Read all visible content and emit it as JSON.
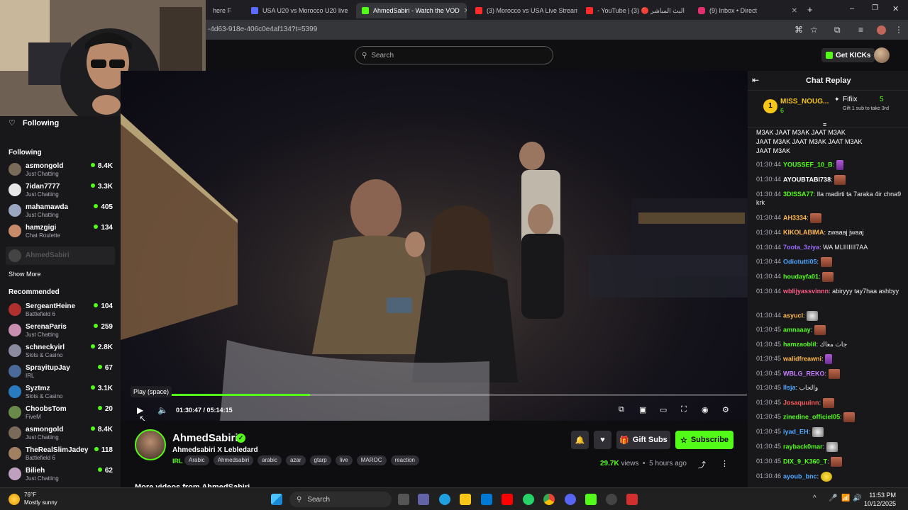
{
  "browser": {
    "tabs": [
      {
        "label": "here F",
        "active": false,
        "color": "#888"
      },
      {
        "label": "USA U20 vs Morocco U20 live",
        "active": false,
        "color": "#5b6cff"
      },
      {
        "label": "AhmedSabiri - Watch the VOD",
        "active": true,
        "color": "#53fc18"
      },
      {
        "label": "(3) Morocco vs USA Live Stream",
        "active": false,
        "color": "#ff2a2a"
      },
      {
        "label": "- YouTube | البث المباشر 🔴 (3)",
        "active": false,
        "color": "#ff2a2a"
      },
      {
        "label": "(9) Inbox • Direct",
        "active": false,
        "color": "#e1306c"
      }
    ],
    "url": "-4d63-918e-406c0e4af134?t=5399"
  },
  "topnav": {
    "search_placeholder": "Search",
    "get_kicks": "Get KICKs"
  },
  "sidebar": {
    "following_title": "Following",
    "following_section": "Following",
    "following": [
      {
        "name": "asmongold",
        "category": "Just Chatting",
        "viewers": "8.4K",
        "color": "#7a6a5a"
      },
      {
        "name": "7idan7777",
        "category": "Just Chatting",
        "viewers": "3.3K",
        "color": "#e8e8e8"
      },
      {
        "name": "mahamawda",
        "category": "Just Chatting",
        "viewers": "405",
        "color": "#9aa7c0"
      },
      {
        "name": "hamzgigi",
        "category": "Chat Roulette",
        "viewers": "134",
        "color": "#c78a6a"
      }
    ],
    "offline_channel": "AhmedSabiri",
    "show_more": "Show More",
    "recommended_title": "Recommended",
    "recommended": [
      {
        "name": "SergeantHeine",
        "category": "Battlefield 6",
        "viewers": "104",
        "color": "#b03030"
      },
      {
        "name": "SerenaParis",
        "category": "Just Chatting",
        "viewers": "259",
        "color": "#c98fb0"
      },
      {
        "name": "schneckyirl",
        "category": "Slots & Casino",
        "viewers": "2.8K",
        "color": "#8a8aa0"
      },
      {
        "name": "SprayitupJay",
        "category": "IRL",
        "viewers": "67",
        "color": "#4a6a9a"
      },
      {
        "name": "Syztmz",
        "category": "Slots & Casino",
        "viewers": "3.1K",
        "color": "#2a7ac0"
      },
      {
        "name": "ChoobsTom",
        "category": "FiveM",
        "viewers": "20",
        "color": "#6a8a4a"
      },
      {
        "name": "asmongold",
        "category": "Just Chatting",
        "viewers": "8.4K",
        "color": "#7a6a5a"
      },
      {
        "name": "TheRealSlimJadey",
        "category": "Battlefield 6",
        "viewers": "118",
        "color": "#a08060"
      },
      {
        "name": "Bilieh",
        "category": "Just Chatting",
        "viewers": "62",
        "color": "#c0a0c0"
      }
    ]
  },
  "player": {
    "tooltip": "Play (space)",
    "time_current": "01:30:47",
    "time_total": "05:14:15",
    "progress": 0.29
  },
  "info": {
    "streamer": "AhmedSabiri",
    "title": "Ahmedsabiri X Lebledard",
    "category": "IRL",
    "tags": [
      "Arabic",
      "Ahmedsabiri",
      "arabic",
      "azar",
      "gtarp",
      "live",
      "MAROC",
      "reaction"
    ],
    "gift_subs": "Gift Subs",
    "subscribe": "Subscribe",
    "views_count": "29.7K",
    "views_label": "views",
    "ago": "5 hours ago",
    "more_videos": "More videos from AhmedSabiri"
  },
  "chat": {
    "title": "Chat Replay",
    "pinned": {
      "rank": "1",
      "top_user": "MISS_NOUG...",
      "top_count": "6",
      "second_user": "Fifiix",
      "second_count": "5",
      "note": "Gift 1 sub to take 3rd"
    },
    "spam_lines": [
      "M3AK  JAAT M3AK  JAAT M3AK",
      "JAAT M3AK  JAAT M3AK  JAAT M3AK",
      "JAAT M3AK"
    ],
    "messages": [
      {
        "time": "01:30:44",
        "user": "YOUSSEF_10_B",
        "color": "#53fc18",
        "text": "",
        "emote": "purple"
      },
      {
        "time": "01:30:44",
        "user": "AYOUBTABI738",
        "color": "#ffffff",
        "text": "",
        "emote": "face-brown"
      },
      {
        "time": "01:30:44",
        "user": "3DISSA77",
        "color": "#53fc18",
        "text": "Ila madirti ta 7araka 4ir chna9 krk",
        "emote": ""
      },
      {
        "time": "01:30:44",
        "user": "AH3334",
        "color": "#ffb84d",
        "text": "",
        "emote": "face-brown"
      },
      {
        "time": "01:30:44",
        "user": "KIKOLABIMA",
        "color": "#ffb84d",
        "text": "zwaaaj jwaaj",
        "emote": ""
      },
      {
        "time": "01:30:44",
        "user": "7oota_3ziya",
        "color": "#9b6bff",
        "text": "WA MLIIIIIII7AA",
        "emote": ""
      },
      {
        "time": "01:30:44",
        "user": "Odiotutti05",
        "color": "#4da6ff",
        "text": "",
        "emote": "face-brown"
      },
      {
        "time": "01:30:44",
        "user": "houdayfa01",
        "color": "#53fc18",
        "text": "",
        "emote": "face-brown"
      },
      {
        "time": "01:30:44",
        "user": "wblijyassvinnn",
        "color": "#ff5c8a",
        "text": "abiryyy tay7haa ashbyy",
        "emote": ""
      },
      {
        "time": "01:30:44",
        "user": "asyucl",
        "color": "#ffb84d",
        "text": "",
        "emote": "face"
      },
      {
        "time": "01:30:45",
        "user": "amnaaay",
        "color": "#53fc18",
        "text": "",
        "emote": "face-brown"
      },
      {
        "time": "01:30:45",
        "user": "hamzaoblil",
        "color": "#53fc18",
        "text": "جات معاك",
        "emote": ""
      },
      {
        "time": "01:30:45",
        "user": "walidfreawni",
        "color": "#ffb84d",
        "text": "",
        "emote": "purple"
      },
      {
        "time": "01:30:45",
        "user": "WBLG_REKO",
        "color": "#c77dff",
        "text": "",
        "emote": "face-brown"
      },
      {
        "time": "01:30:45",
        "user": "Ilsja",
        "color": "#4da6ff",
        "text": "والحاب",
        "emote": ""
      },
      {
        "time": "01:30:45",
        "user": "Josaquuinn",
        "color": "#ff5c5c",
        "text": "",
        "emote": "face-brown"
      },
      {
        "time": "01:30:45",
        "user": "zinedine_officiel05",
        "color": "#53fc18",
        "text": "",
        "emote": "face-brown"
      },
      {
        "time": "01:30:45",
        "user": "iyad_EH",
        "color": "#4da6ff",
        "text": "",
        "emote": "face"
      },
      {
        "time": "01:30:45",
        "user": "rayback0mar",
        "color": "#53fc18",
        "text": "",
        "emote": "face"
      },
      {
        "time": "01:30:45",
        "user": "DIX_9_K360_T",
        "color": "#53fc18",
        "text": "",
        "emote": "face-brown"
      },
      {
        "time": "01:30:46",
        "user": "ayoub_bnc",
        "color": "#4da6ff",
        "text": "",
        "emote": "yellow"
      }
    ]
  },
  "taskbar": {
    "weather_temp": "76°F",
    "weather_desc": "Mostly sunny",
    "search": "Search",
    "time": "11:53 PM",
    "date": "10/12/2025"
  },
  "colors": {
    "accent": "#53fc18",
    "background": "#0e0e10",
    "panel": "#18181b"
  }
}
